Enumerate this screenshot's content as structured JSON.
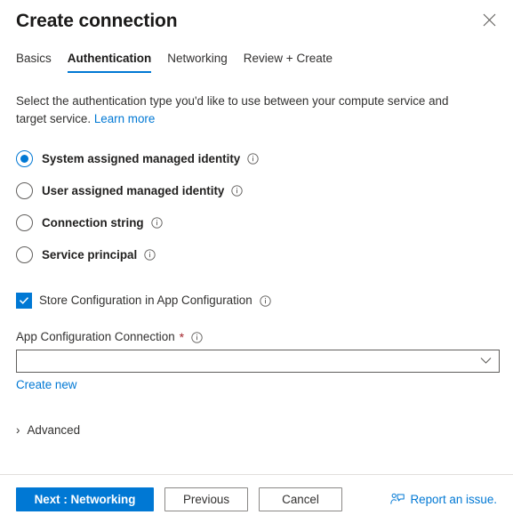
{
  "header": {
    "title": "Create connection",
    "close_label": "Close"
  },
  "tabs": [
    {
      "label": "Basics",
      "active": false
    },
    {
      "label": "Authentication",
      "active": true
    },
    {
      "label": "Networking",
      "active": false
    },
    {
      "label": "Review + Create",
      "active": false
    }
  ],
  "description": {
    "text": "Select the authentication type you'd like to use between your compute service and target service.",
    "link_text": "Learn more"
  },
  "auth_options": [
    {
      "label": "System assigned managed identity",
      "selected": true,
      "info": true
    },
    {
      "label": "User assigned managed identity",
      "selected": false,
      "info": true
    },
    {
      "label": "Connection string",
      "selected": false,
      "info": true
    },
    {
      "label": "Service principal",
      "selected": false,
      "info": true
    }
  ],
  "store_config": {
    "label": "Store Configuration in App Configuration",
    "checked": true,
    "info": true
  },
  "app_config_field": {
    "label": "App Configuration Connection",
    "required_marker": "*",
    "value": "",
    "placeholder": "",
    "create_new_label": "Create new"
  },
  "advanced": {
    "label": "Advanced",
    "chevron": "›",
    "expanded": false
  },
  "footer": {
    "next_label": "Next : Networking",
    "previous_label": "Previous",
    "cancel_label": "Cancel",
    "report_issue_label": "Report an issue."
  },
  "colors": {
    "accent": "#0078d4",
    "link": "#0078d4",
    "required": "#a4262c",
    "text": "#323130",
    "border": "#605e5c",
    "divider": "#e1dfdd"
  }
}
